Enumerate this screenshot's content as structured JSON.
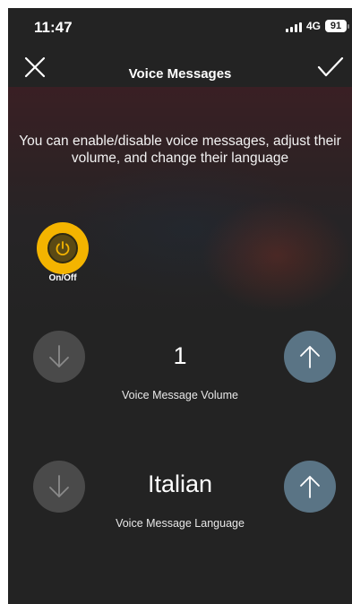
{
  "status_bar": {
    "time": "11:47",
    "network": "4G",
    "battery": "91"
  },
  "header": {
    "title": "Voice Messages",
    "close_icon": "close-icon",
    "confirm_icon": "checkmark-icon"
  },
  "description": "You can enable/disable voice messages, adjust their volume, and change their language",
  "power": {
    "label": "On/Off",
    "icon": "power-icon",
    "color": "#f4b400"
  },
  "volume": {
    "value": "1",
    "label": "Voice Message Volume"
  },
  "language": {
    "value": "Italian",
    "label": "Voice Message Language"
  },
  "colors": {
    "background": "#232323",
    "up_button": "#5a7485",
    "down_button": "#4a4a4a"
  }
}
